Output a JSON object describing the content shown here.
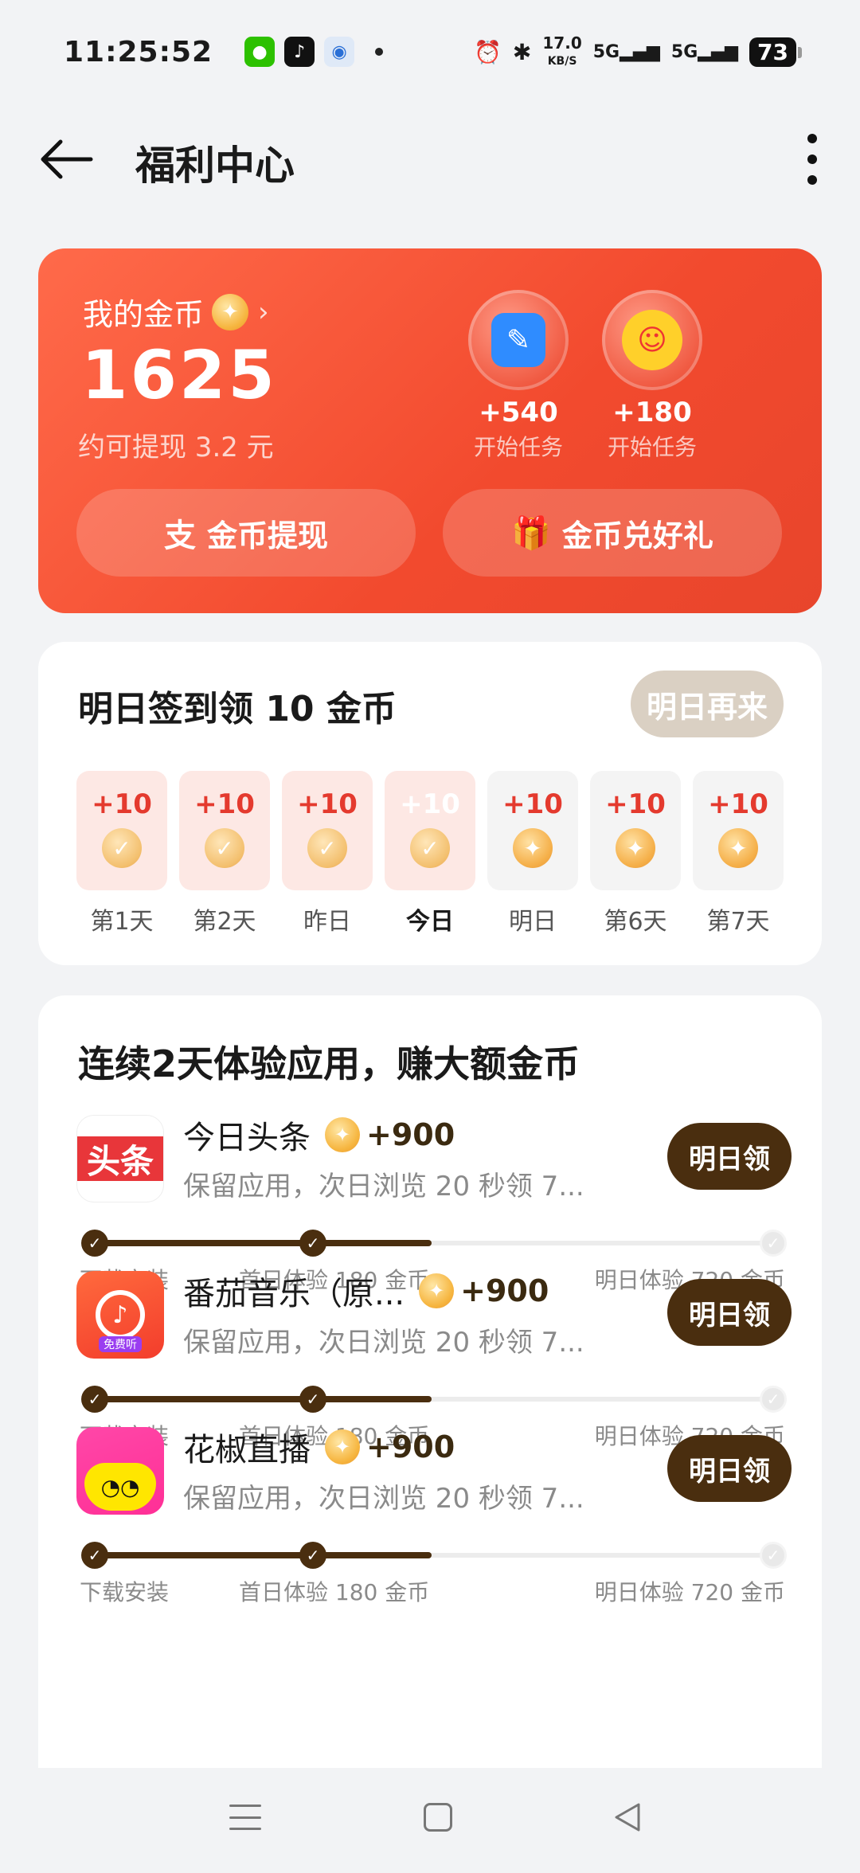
{
  "status_bar": {
    "time": "11:25:52",
    "net_speed_value": "17.0",
    "net_speed_unit": "KB/S",
    "signal1": "5G",
    "signal2": "5G",
    "battery": "73",
    "icons": [
      "wechat-icon",
      "tiktok-icon",
      "bot-app-icon",
      "alarm-icon",
      "bluetooth-icon"
    ]
  },
  "header": {
    "title": "福利中心"
  },
  "coin_card": {
    "label": "我的金币",
    "balance": "1625",
    "cash_estimate": "约可提现 3.2 元",
    "tasks": [
      {
        "reward": "+540",
        "label": "开始任务"
      },
      {
        "reward": "+180",
        "label": "开始任务"
      }
    ],
    "withdraw_label": "金币提现",
    "exchange_label": "金币兑好礼"
  },
  "checkin": {
    "title": "明日签到领 10 金币",
    "status_button": "明日再来",
    "days": [
      {
        "amount": "+10",
        "label": "第1天",
        "state": "done"
      },
      {
        "amount": "+10",
        "label": "第2天",
        "state": "done"
      },
      {
        "amount": "+10",
        "label": "昨日",
        "state": "done"
      },
      {
        "amount": "+10",
        "label": "今日",
        "state": "today"
      },
      {
        "amount": "+10",
        "label": "明日",
        "state": "future"
      },
      {
        "amount": "+10",
        "label": "第6天",
        "state": "future"
      },
      {
        "amount": "+10",
        "label": "第7天",
        "state": "future"
      }
    ]
  },
  "apps_section": {
    "title": "连续2天体验应用，赚大额金币",
    "apps": [
      {
        "name": "今日头条",
        "icon_text": "头条",
        "bonus": "+900",
        "desc": "保留应用，次日浏览 20 秒领 7...",
        "claim": "明日领",
        "steps": [
          "下载安装",
          "首日体验 180 金币",
          "明日体验 720 金币"
        ],
        "progress": 0.5
      },
      {
        "name": "番茄音乐（原...",
        "icon_text": "免费听",
        "bonus": "+900",
        "desc": "保留应用，次日浏览 20 秒领 7...",
        "claim": "明日领",
        "steps": [
          "下载安装",
          "首日体验 180 金币",
          "明日体验 720 金币"
        ],
        "progress": 0.5
      },
      {
        "name": "花椒直播",
        "icon_text": "",
        "bonus": "+900",
        "desc": "保留应用，次日浏览 20 秒领 7...",
        "claim": "明日领",
        "steps": [
          "下载安装",
          "首日体验 180 金币",
          "明日体验 720 金币"
        ],
        "progress": 0.5
      }
    ]
  },
  "colors": {
    "card_red": "#f24a2e",
    "claim_brown": "#4a2e0f",
    "coin_gold": "#f5b04a",
    "accent_red": "#e43a2e"
  }
}
